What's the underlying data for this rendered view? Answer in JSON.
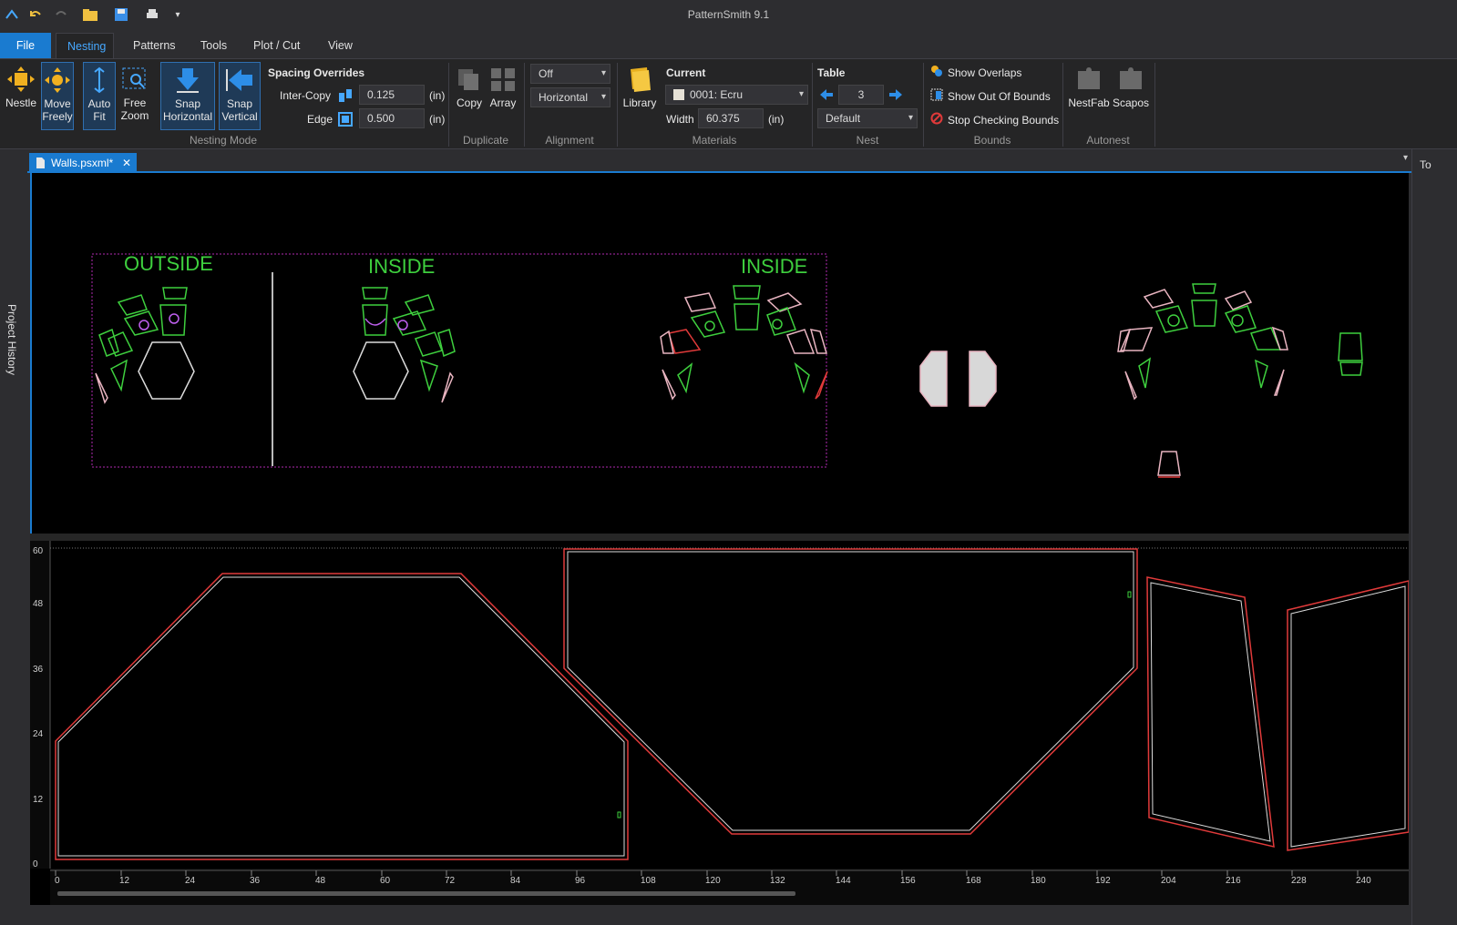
{
  "app": {
    "title": "PatternSmith 9.1"
  },
  "menu": {
    "file": "File",
    "nesting": "Nesting",
    "patterns": "Patterns",
    "tools": "Tools",
    "plot_cut": "Plot / Cut",
    "view": "View"
  },
  "ribbon": {
    "nesting_mode": {
      "label": "Nesting Mode",
      "nestle": "Nestle",
      "move_freely": [
        "Move",
        "Freely"
      ],
      "auto_fit": [
        "Auto",
        "Fit"
      ],
      "free_zoom": [
        "Free",
        "Zoom"
      ],
      "snap_horizontal": [
        "Snap",
        "Horizontal"
      ],
      "snap_vertical": [
        "Snap",
        "Vertical"
      ],
      "spacing_title": "Spacing Overrides",
      "inter_copy_label": "Inter-Copy",
      "inter_copy_value": "0.125",
      "edge_label": "Edge",
      "edge_value": "0.500",
      "unit": "(in)"
    },
    "duplicate": {
      "label": "Duplicate",
      "copy": "Copy",
      "array": "Array"
    },
    "alignment": {
      "label": "Alignment",
      "mode": "Off",
      "direction": "Horizontal"
    },
    "materials": {
      "label": "Materials",
      "library": "Library",
      "current_title": "Current",
      "current_value": "0001: Ecru",
      "width_label": "Width",
      "width_value": "60.375",
      "unit": "(in)"
    },
    "nest": {
      "label": "Nest",
      "table_title": "Table",
      "table_value": "3",
      "preset": "Default"
    },
    "bounds": {
      "label": "Bounds",
      "show_overlaps": "Show Overlaps",
      "show_out_of_bounds": "Show Out Of Bounds",
      "stop_checking": "Stop Checking Bounds"
    },
    "autonest": {
      "label": "Autonest",
      "nestfab": "NestFab",
      "scapos": "Scapos"
    }
  },
  "side_panel": {
    "project_history": "Project History",
    "right_tab": "To"
  },
  "document": {
    "tab": "Walls.psxml*"
  },
  "canvas": {
    "labels": {
      "outside": "OUTSIDE",
      "inside_1": "INSIDE",
      "inside_2": "INSIDE"
    },
    "ruler_y": [
      "0",
      "12",
      "24",
      "36",
      "48",
      "60"
    ],
    "ruler_x": [
      "0",
      "12",
      "24",
      "36",
      "48",
      "60",
      "72",
      "84",
      "96",
      "108",
      "120",
      "132",
      "144",
      "156",
      "168",
      "180",
      "192",
      "204",
      "216",
      "228",
      "240"
    ]
  },
  "colors": {
    "accent": "#1a7bd0",
    "piece_green": "#3ecf3e",
    "piece_pink": "#e8b4c0",
    "piece_red": "#e03a3a",
    "boundary_magenta": "#b02ab0"
  }
}
